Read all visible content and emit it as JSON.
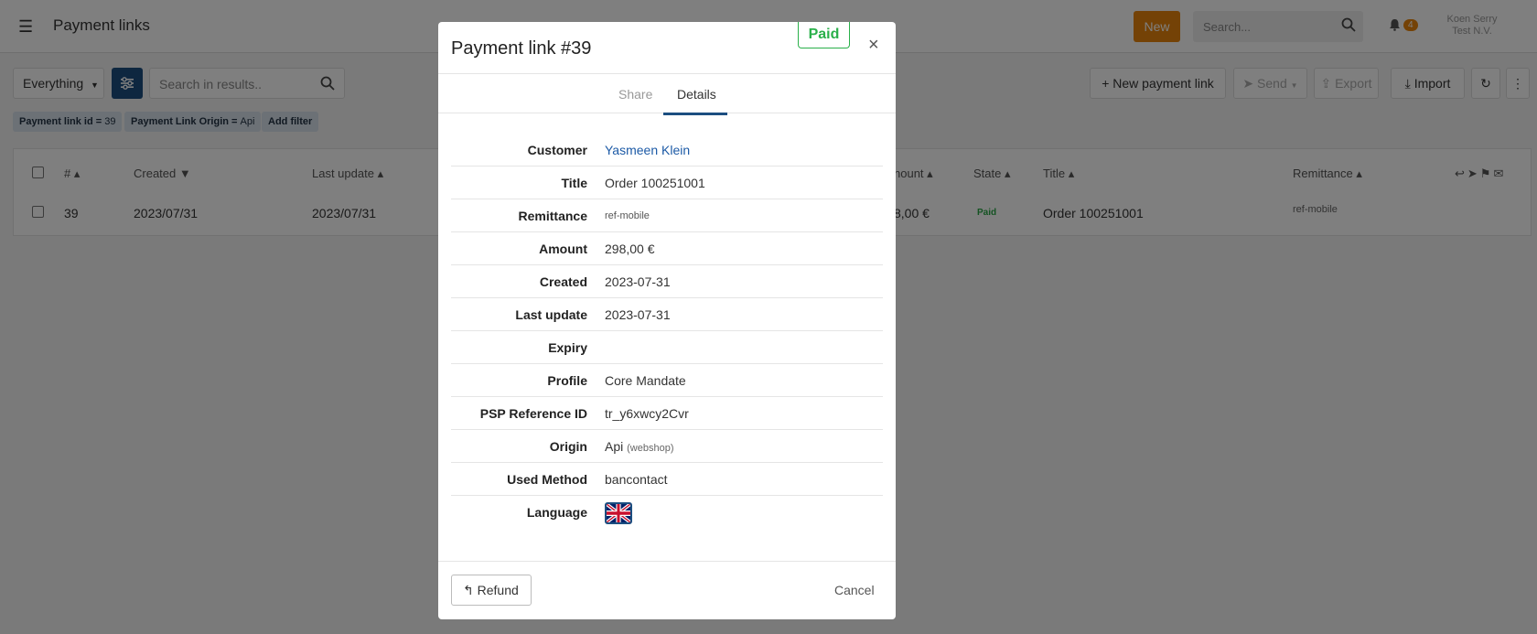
{
  "header": {
    "title": "Payment links",
    "new_label": "New",
    "search_placeholder": "Search...",
    "notifications_count": "4",
    "user_name": "Koen Serry",
    "user_company": "Test N.V."
  },
  "toolbar": {
    "scope_label": "Everything",
    "search_placeholder": "Search in results..",
    "new_payment_link_label": "New payment link",
    "send_label": "Send",
    "export_label": "Export",
    "import_label": "Import"
  },
  "filters": [
    {
      "key": "Payment link id =",
      "value": "39"
    },
    {
      "key": "Payment Link Origin =",
      "value": "Api"
    }
  ],
  "add_filter_label": "Add filter",
  "table": {
    "columns": [
      "#",
      "Created",
      "Last update",
      "Amount",
      "State",
      "Title",
      "Remittance"
    ],
    "amount_header_partial": "nount",
    "row": {
      "id": "39",
      "created": "2023/07/31",
      "last_update": "2023/07/31",
      "amount_partial": "8,00 €",
      "state": "Paid",
      "title": "Order 100251001",
      "remittance": "ref-mobile"
    }
  },
  "modal": {
    "title": "Payment link #39",
    "status_stamp": "Paid",
    "close_symbol": "×",
    "tabs": [
      "Share",
      "Details"
    ],
    "active_tab": "Details",
    "details": {
      "customer": {
        "label": "Customer",
        "value": "Yasmeen Klein"
      },
      "title": {
        "label": "Title",
        "value": "Order 100251001"
      },
      "remittance": {
        "label": "Remittance",
        "value": "ref-mobile"
      },
      "amount": {
        "label": "Amount",
        "value": "298,00 €"
      },
      "created": {
        "label": "Created",
        "value": "2023-07-31"
      },
      "last_update": {
        "label": "Last update",
        "value": "2023-07-31"
      },
      "expiry": {
        "label": "Expiry",
        "value": ""
      },
      "profile": {
        "label": "Profile",
        "value": "Core Mandate"
      },
      "psp_reference": {
        "label": "PSP Reference ID",
        "value": "tr_y6xwcy2Cvr"
      },
      "origin": {
        "label": "Origin",
        "value": "Api",
        "sub": "(webshop)"
      },
      "used_method": {
        "label": "Used Method",
        "value": "bancontact"
      },
      "language": {
        "label": "Language",
        "value_icon": "uk-flag-icon"
      }
    },
    "footer": {
      "refund_label": "Refund",
      "cancel_label": "Cancel"
    }
  },
  "colors": {
    "brand_primary": "#1c4e80",
    "accent_orange": "#e8850c",
    "paid_green": "#2ab04a",
    "link_blue": "#1c5aa6"
  }
}
